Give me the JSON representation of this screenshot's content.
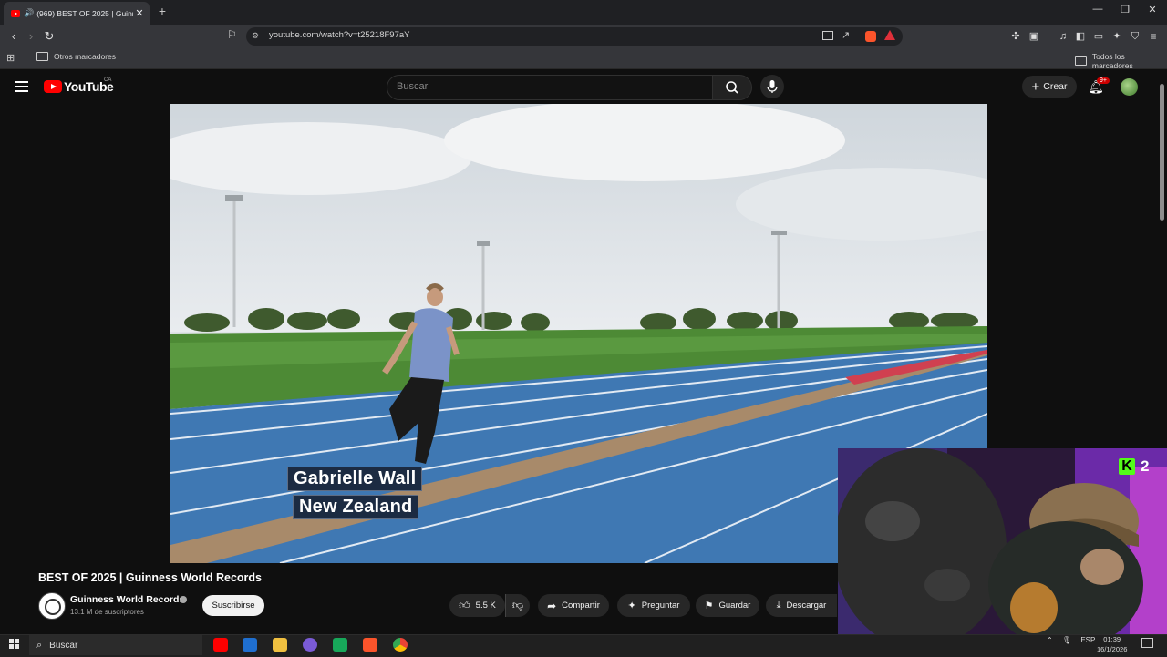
{
  "browser": {
    "tab_title": "(969) BEST OF 2025 | Guinness...",
    "tab_close": "✕",
    "new_tab": "+",
    "url": "youtube.com/watch?v=t25218F97aY",
    "bookmarks_left": "Otros marcadores",
    "bookmarks_right": "Todos los marcadores",
    "window_controls": [
      "—",
      "❐",
      "✕"
    ]
  },
  "youtube": {
    "logo_text": "YouTube",
    "country": "CA",
    "search_placeholder": "Buscar",
    "create_label": "Crear",
    "notifications_badge": "9+"
  },
  "video": {
    "lower_third_name": "Gabrielle Wall",
    "lower_third_country": "New Zealand"
  },
  "webcam": {
    "kick_logo": "K",
    "kick_count": "2"
  },
  "info": {
    "title": "BEST OF 2025 | Guinness World Records",
    "channel": "Guinness World Records",
    "subscribers": "13.1 M de suscriptores",
    "subscribe_label": "Suscribirse",
    "likes": "5.5 K",
    "share_label": "Compartir",
    "ask_label": "Preguntar",
    "save_label": "Guardar",
    "download_label": "Descargar"
  },
  "taskbar": {
    "search_placeholder": "Buscar",
    "language": "ESP",
    "time": "01:39",
    "date": "16/1/2026"
  }
}
